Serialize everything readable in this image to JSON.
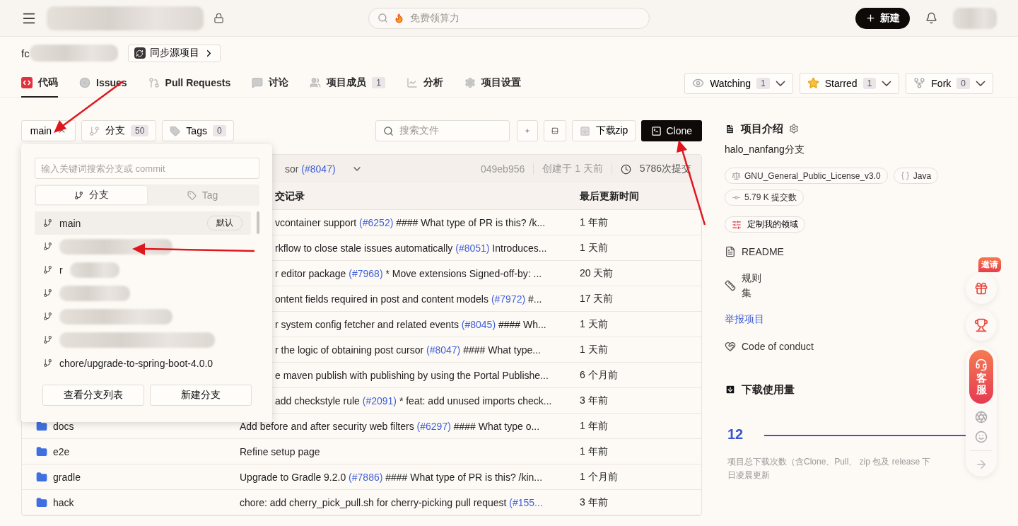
{
  "header": {
    "search_placeholder": "免费领算力",
    "new_button": "新建"
  },
  "repo": {
    "owner_visible": "fc",
    "sync_button": "同步源项目"
  },
  "nav_tabs": [
    {
      "label": "代码",
      "selected": true
    },
    {
      "label": "Issues",
      "selected": false
    },
    {
      "label": "Pull Requests",
      "selected": false
    },
    {
      "label": "讨论",
      "selected": false
    },
    {
      "label": "项目成员",
      "count": "1",
      "selected": false
    },
    {
      "label": "分析",
      "selected": false
    },
    {
      "label": "项目设置",
      "selected": false
    }
  ],
  "repo_actions": [
    {
      "label": "Watching",
      "count": "1"
    },
    {
      "label": "Starred",
      "count": "1"
    },
    {
      "label": "Fork",
      "count": "0"
    }
  ],
  "toolbar": {
    "branch": "main",
    "expanded": true,
    "branches": {
      "label": "分支",
      "count": "50"
    },
    "tags": {
      "label": "Tags",
      "count": "0"
    },
    "file_search_placeholder": "搜索文件",
    "download": "下载zip",
    "clone": "Clone"
  },
  "branch_popup": {
    "search_placeholder": "输入关键词搜索分支或 commit",
    "tabs": [
      {
        "label": "分支",
        "selected": true
      },
      {
        "label": "Tag",
        "selected": false
      }
    ],
    "branches": [
      {
        "kind": "branch",
        "name": "main",
        "badge": "默认",
        "selected": true
      },
      {
        "kind": "redacted",
        "selected": false
      },
      {
        "kind": "redacted",
        "name": "r",
        "selected": false
      },
      {
        "kind": "redacted",
        "selected": false
      },
      {
        "kind": "redacted",
        "selected": false
      },
      {
        "kind": "redacted",
        "selected": false
      },
      {
        "kind": "branch",
        "name": "chore/upgrade-to-spring-boot-4.0.0",
        "selected": false
      }
    ],
    "buttons": [
      "查看分支列表",
      "新建分支"
    ]
  },
  "latest_commit": {
    "message": "sor ",
    "pr": "(#8047)",
    "hash": "049eb956",
    "created": "创建于 1 天前",
    "commits": "5786次提交"
  },
  "files": {
    "columns": [
      "交记录",
      "最后更新时间"
    ],
    "rows": [
      {
        "message": "vcontainer support ",
        "pr": "(#6252)",
        "rest": " #### What type of PR is this? /k...",
        "time": "1 年前"
      },
      {
        "message": "rkflow to close stale issues automatically ",
        "pr": "(#8051)",
        "rest": " Introduces...",
        "time": "1 天前"
      },
      {
        "message": "r editor package ",
        "pr": "(#7968)",
        "rest": " * Move extensions Signed-off-by: ...",
        "time": "20 天前"
      },
      {
        "message": "ontent fields required in post and content models ",
        "pr": "(#7972)",
        "rest": " #...",
        "time": "17 天前"
      },
      {
        "message": "r system config fetcher and related events ",
        "pr": "(#8045)",
        "rest": " #### Wh...",
        "time": "1 天前"
      },
      {
        "message": "r the logic of obtaining post cursor ",
        "pr": "(#8047)",
        "rest": " #### What type...",
        "time": "1 天前"
      },
      {
        "message": "e maven publish with publishing by using the Portal Publishe...",
        "time": "6 个月前"
      },
      {
        "message": "add checkstyle rule ",
        "pr": "(#2091)",
        "rest": " * feat: add unused imports check...",
        "time": "3 年前"
      },
      {
        "name": "docs",
        "message": "Add before and after security web filters ",
        "pr": "(#6297)",
        "rest": " #### What type o...",
        "time": "1 年前"
      },
      {
        "name": "e2e",
        "message": "Refine setup page",
        "time": "1 年前"
      },
      {
        "name": "gradle",
        "message": "Upgrade to Gradle 9.2.0 ",
        "pr": "(#7886)",
        "rest": " #### What type of PR is this? /kin...",
        "time": "1 个月前"
      },
      {
        "name": "hack",
        "message": "chore: add cherry_pick_pull.sh for cherry-picking pull request ",
        "pr": "(#155...",
        "time": "3 年前"
      }
    ]
  },
  "sidebar": {
    "title": "项目介绍",
    "description": "halo_nanfang分支",
    "chips": [
      {
        "kind": "license",
        "label": "GNU_General_Public_License_v3.0"
      },
      {
        "kind": "language",
        "label": "Java"
      },
      {
        "kind": "commits",
        "label": "5.79 K 提交数"
      }
    ],
    "domain_button": "定制我的领域",
    "links": [
      {
        "kind": "readme",
        "label": "README"
      },
      {
        "kind": "rules",
        "label": "规则集"
      },
      {
        "kind": "report",
        "label": "举报项目"
      },
      {
        "kind": "conduct",
        "label": "Code of conduct"
      }
    ],
    "downloads": {
      "title": "下载使用量",
      "count": "12",
      "caption_lines": [
        "项目总下载次数（含Clone、Pull、 zip 包及 release 下",
        "日凌晨更新"
      ]
    }
  },
  "float_widget": {
    "badge": "邀请",
    "service": "客服"
  }
}
